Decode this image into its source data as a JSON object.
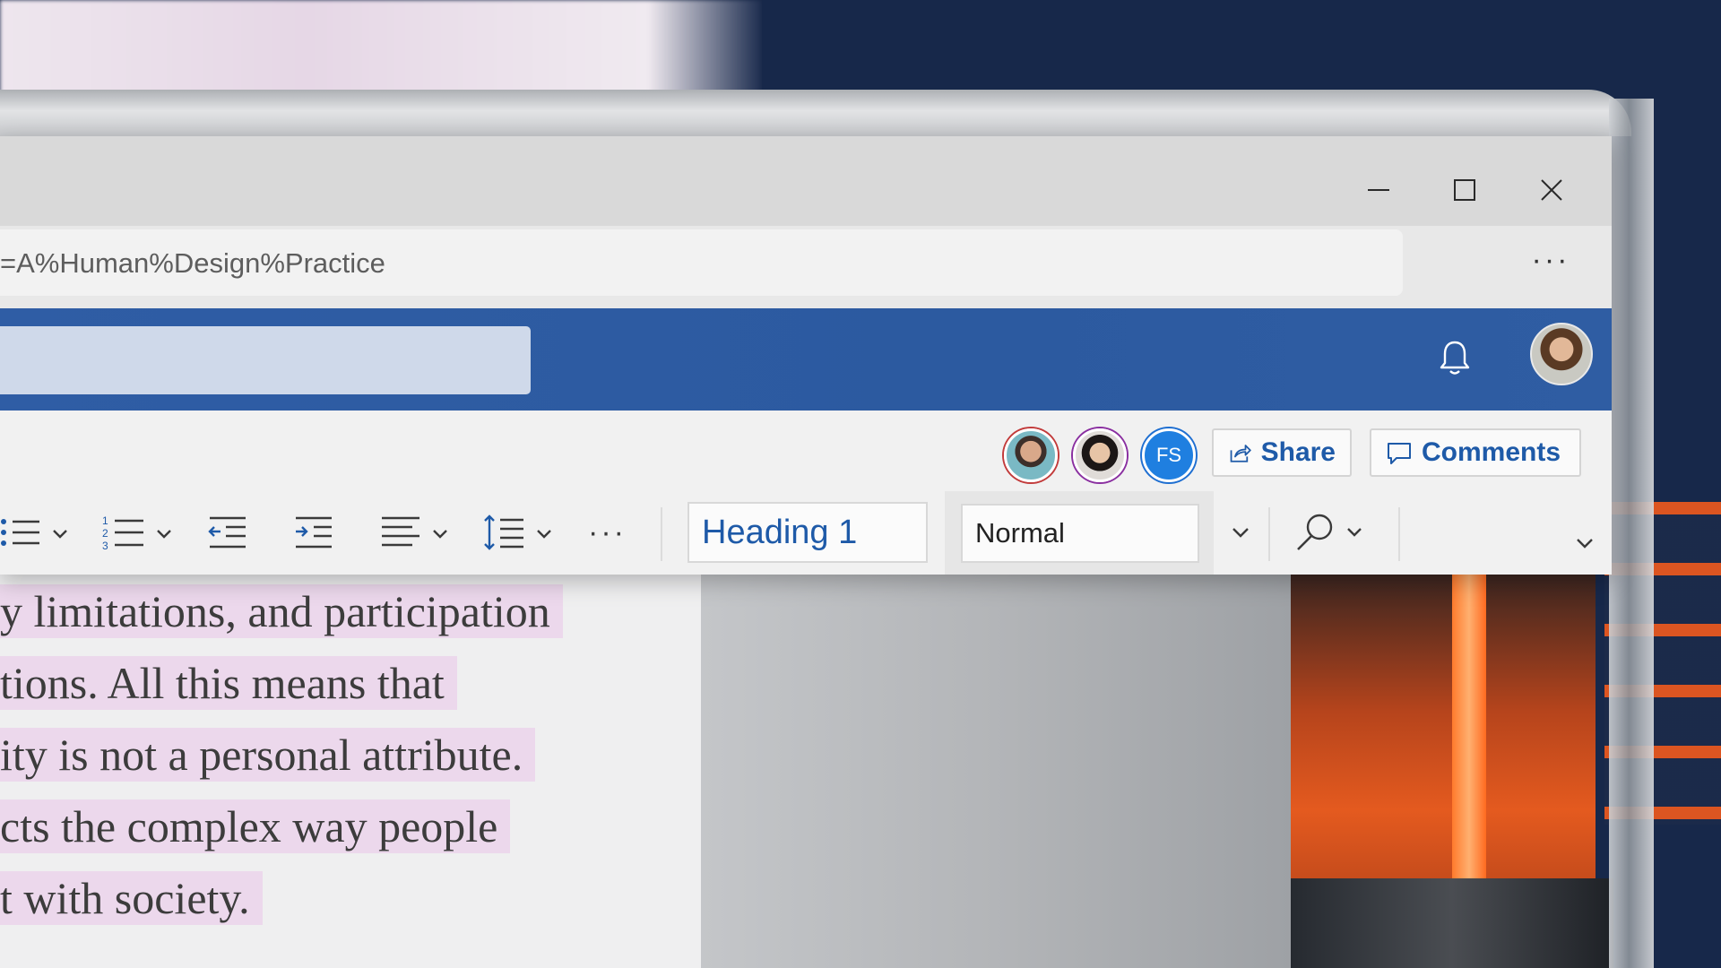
{
  "window": {
    "controls": {
      "minimize": "minimize",
      "maximize": "maximize",
      "close": "close"
    }
  },
  "address_bar": {
    "text": "=A%Human%Design%Practice",
    "more_label": "···"
  },
  "header": {
    "notifications_icon": "bell-icon",
    "user_avatar": "profile-photo"
  },
  "collaborators": [
    {
      "type": "photo",
      "ring_color": "#c23b3b"
    },
    {
      "type": "photo",
      "ring_color": "#8a2fa0"
    },
    {
      "type": "initials",
      "initials": "FS",
      "ring_color": "#1f6fd1"
    }
  ],
  "actions": {
    "share_label": "Share",
    "comments_label": "Comments"
  },
  "ribbon": {
    "more_label": "···",
    "heading_style": "Heading 1",
    "paragraph_style": "Normal"
  },
  "document": {
    "lines": [
      "y limitations, and participation",
      "tions. All this means that",
      "ity is not a personal attribute.",
      "cts the complex way people",
      "t with society."
    ]
  },
  "colors": {
    "accent": "#2c5aa0",
    "link_text": "#1e5aa8",
    "highlight": "#ecd8ec"
  }
}
